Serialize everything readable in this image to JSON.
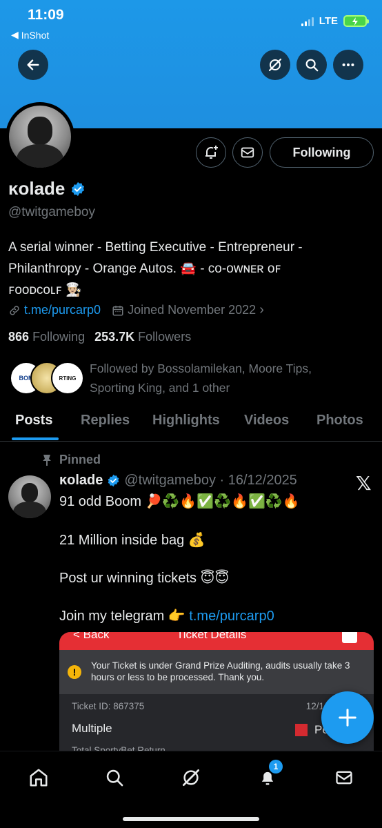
{
  "status_bar": {
    "time": "11:09",
    "back_app": "InShot",
    "network": "LTE"
  },
  "profile": {
    "name": "ĸolade",
    "handle": "@twitgameboy",
    "bio_line1": "A serial winner - Betting Executive - Entrepreneur -",
    "bio_line2": "Philanthropy - Orange Autos. 🚘 - ᴄᴏ-ᴏᴡɴᴇʀ ᴏꜰ",
    "bio_line3": "ꜰᴏᴏᴅᴄᴏʟꜰ 👨🏼‍🍳",
    "link": "t.me/purcarp0",
    "joined": "Joined November 2022",
    "following_count": "866",
    "following_label": "Following",
    "followers_count": "253.7K",
    "followers_label": "Followers",
    "followed_by_line1": "Followed by Bossolamilekan, Moore Tips,",
    "followed_by_line2": "Sporting King, and 1 other",
    "following_button": "Following"
  },
  "follower_avatars": [
    {
      "label": "BOM",
      "color": "#ffffff"
    },
    {
      "label": "",
      "color": "#c9a94c"
    },
    {
      "label": "RTING",
      "color": "#ffffff"
    }
  ],
  "tabs": [
    "Posts",
    "Replies",
    "Highlights",
    "Videos",
    "Photos"
  ],
  "post": {
    "pinned_label": "Pinned",
    "author_name": "ĸolade",
    "author_meta": "@twitgameboy · 16/12/2025",
    "line1": "91 odd Boom 🏓♻️🔥✅♻️🔥✅♻️🔥",
    "line2": "21 Million inside bag 💰",
    "line3": "Post ur winning tickets 😇😇",
    "line4_text": "Join my telegram 👉",
    "line4_link": "t.me/purcarp0"
  },
  "ticket": {
    "back": "< Back",
    "title": "Ticket Details",
    "notice": "Your Ticket is under Grand Prize Auditing, audits usually take 3 hours or less to be processed. Thank you.",
    "ticket_id": "Ticket ID: 867375",
    "date": "12/1",
    "type": "Multiple",
    "status": "Pe",
    "return_label": "Total SportyBet Return"
  },
  "notifications_badge": "1",
  "colors": {
    "accent": "#1d9bf0",
    "banner": "#1d98e8",
    "background": "#000000",
    "muted": "#71767b"
  }
}
